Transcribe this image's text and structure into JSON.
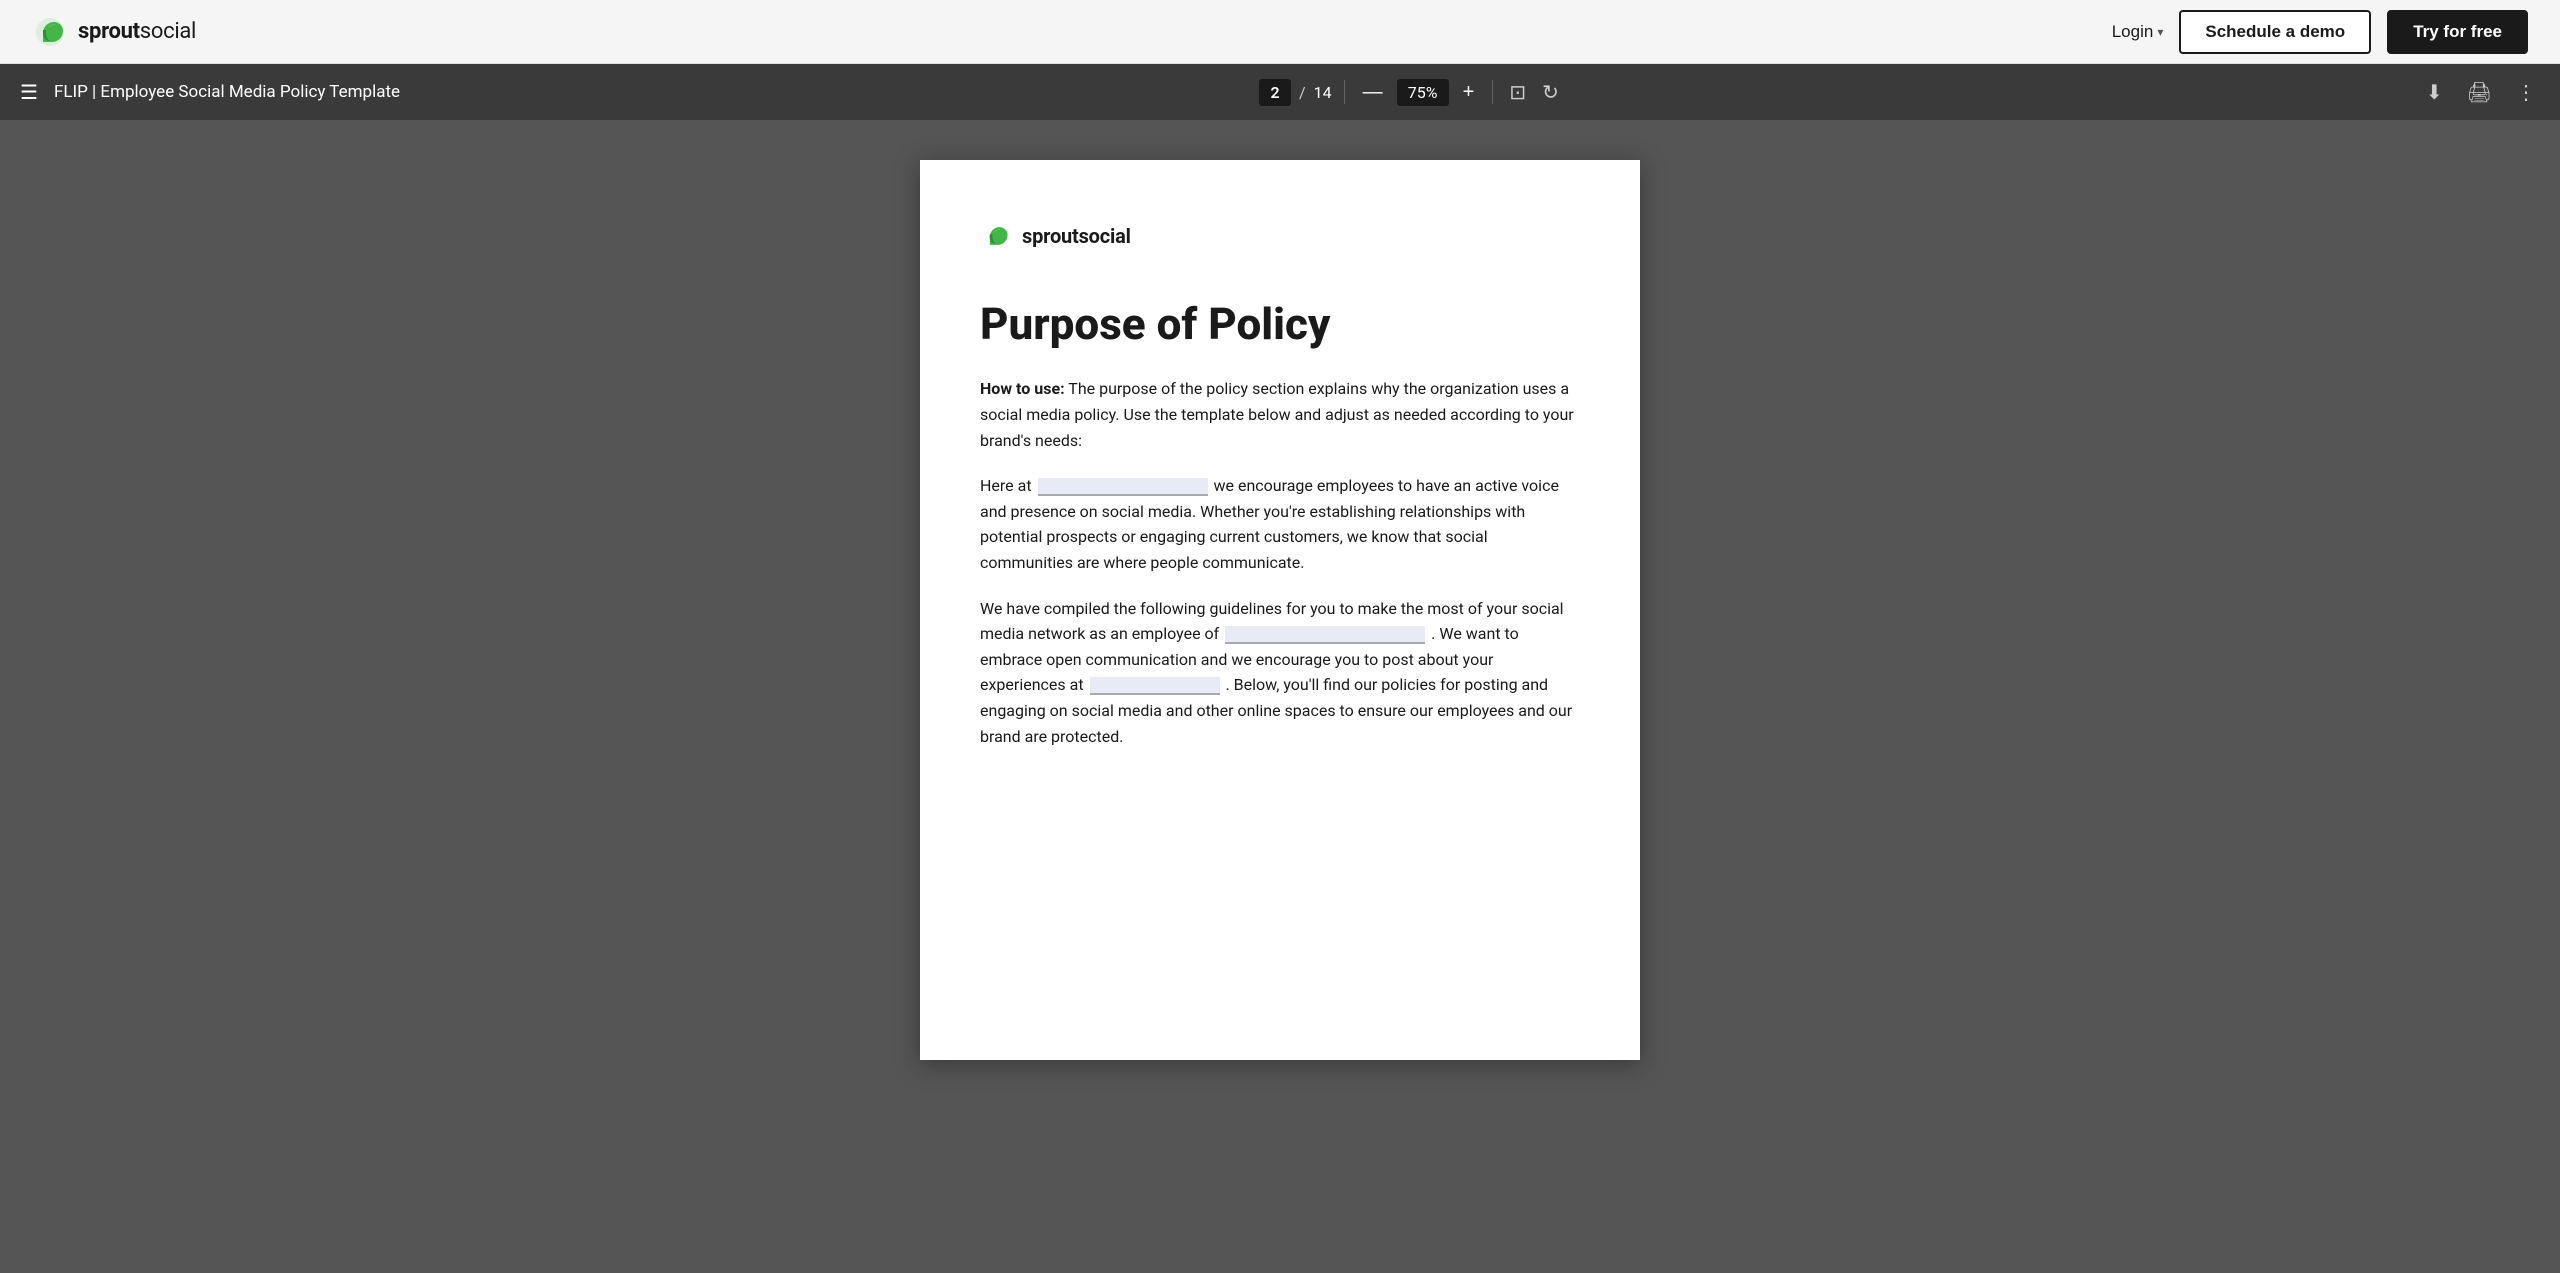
{
  "topnav": {
    "logo_alt": "Sprout Social",
    "logo_wordmark_bold": "sprout",
    "logo_wordmark_light": "social",
    "login_label": "Login",
    "schedule_label": "Schedule a demo",
    "try_label": "Try for free"
  },
  "toolbar": {
    "hamburger_icon": "☰",
    "doc_title": "FLIP | Employee Social Media Policy Template",
    "current_page": "2",
    "page_sep": "/",
    "total_pages": "14",
    "zoom_minus": "—",
    "zoom_value": "75%",
    "zoom_plus": "+",
    "expand_icon": "⊡",
    "rotate_icon": "↻",
    "download_icon": "⬇",
    "print_icon": "🖨",
    "more_icon": "⋮"
  },
  "document": {
    "logo_bold": "sprout",
    "logo_light": "social",
    "heading": "Purpose of Policy",
    "how_to_label": "How to use:",
    "how_to_text": " The purpose of the policy section explains why the organization uses a social media policy. Use the template below and adjust as needed according to your brand's needs:",
    "para1_before": "Here at",
    "para1_after": "we encourage employees to have an active voice and presence on social media. Whether you're establishing relationships with potential prospects or engaging current customers, we know that social communities are where people communicate.",
    "para2_before": "We have compiled the following guidelines for you to make the most of your social media network as an employee of",
    "para2_mid": ". We want to embrace open communication and we encourage you to post about your experiences at",
    "para2_after": ". Below, you'll find our policies for posting and engaging on social media and other online spaces to ensure our employees and our brand are protected."
  }
}
